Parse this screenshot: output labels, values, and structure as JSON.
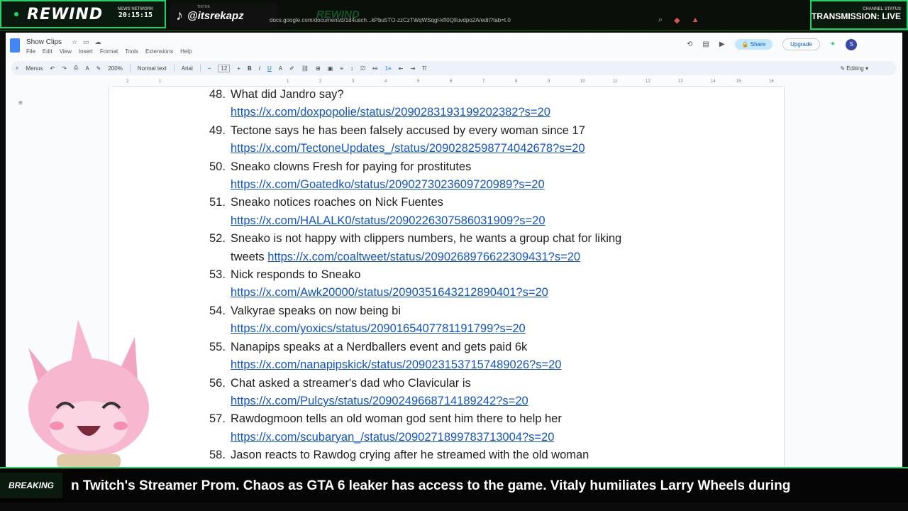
{
  "stream": {
    "brand": "REWIND",
    "clock_label": "NEWS NETWORK",
    "clock_time": "20:15:15",
    "tiktok_label": "TIKTOK",
    "tiktok_handle": "@itsrekapz",
    "ghost_brand": "REWIND",
    "status_label": "CHANNEL STATUS",
    "status_value": "TRANSMISSION: LIVE",
    "breaking_label": "BREAKING",
    "ticker": "n Twitch's Streamer Prom. Chaos as GTA 6 leaker has access to the game. Vitaly humiliates Larry Wheels during",
    "accent_color": "#22d36a"
  },
  "browser": {
    "url": "docs.google.com/document/d/1d4usch...kPbu5TO-zzCzTWqWSqgl-kfI0QlIuvdpo2A/edit?tab=t.0"
  },
  "docs": {
    "title": "Show Clips",
    "menu": [
      "File",
      "Edit",
      "View",
      "Insert",
      "Format",
      "Tools",
      "Extensions",
      "Help"
    ],
    "share_label": "Share",
    "upgrade_label": "Upgrade",
    "avatar_initial": "S",
    "toolbar": {
      "menus_label": "Menus",
      "zoom": "200%",
      "style": "Normal text",
      "font": "Arial",
      "font_size": "12",
      "mode": "Editing"
    },
    "ruler_ticks": [
      "2",
      "1",
      "1",
      "1",
      "2",
      "3",
      "4",
      "5",
      "6",
      "7",
      "8",
      "9",
      "10",
      "11",
      "12",
      "13",
      "14",
      "15",
      "16",
      "17",
      "18"
    ]
  },
  "items": [
    {
      "num": "48.",
      "text": "What did Jandro say?",
      "link": "https://x.com/doxpopolie/status/2090283193199202382?s=20",
      "link_inline": false
    },
    {
      "num": "49.",
      "text": "Tectone says he has been falsely accused by every woman since 17",
      "link": "https://x.com/TectoneUpdates_/status/2090282598774042678?s=20",
      "link_inline": false
    },
    {
      "num": "50.",
      "text": "Sneako clowns Fresh for paying for prostitutes",
      "link": "https://x.com/Goatedko/status/2090273023609720989?s=20",
      "link_inline": false
    },
    {
      "num": "51.",
      "text": "Sneako notices roaches on Nick Fuentes",
      "link": "https://x.com/HALALK0/status/2090226307586031909?s=20",
      "link_inline": false
    },
    {
      "num": "52.",
      "text": "Sneako is not happy with clippers numbers, he wants a group chat for liking",
      "text2": "tweets",
      "link": "https://x.com/coaltweet/status/2090268976622309431?s=20",
      "link_inline": true
    },
    {
      "num": "53.",
      "text": "Nick responds to Sneako",
      "link": "https://x.com/Awk20000/status/2090351643212890401?s=20",
      "link_inline": false
    },
    {
      "num": "54.",
      "text": "Valkyrae speaks on now being bi",
      "link": "https://x.com/yoxics/status/2090165407781191799?s=20",
      "link_inline": false
    },
    {
      "num": "55.",
      "text": "Nanapips speaks at a Nerdballers event and gets paid 6k",
      "link": "https://x.com/nanapipskick/status/2090231537157489026?s=20",
      "link_inline": false
    },
    {
      "num": "56.",
      "text": "Chat asked a streamer's dad who Clavicular is",
      "link": "https://x.com/Pulcys/status/2090249668714189242?s=20",
      "link_inline": false
    },
    {
      "num": "57.",
      "text": "Rawdogmoon tells an old woman god sent him there to help her",
      "link": "https://x.com/scubaryan_/status/2090271899783713004?s=20",
      "link_inline": false
    },
    {
      "num": "58.",
      "text": "Jason reacts to Rawdog crying after he streamed with the old woman",
      "link": "",
      "link_inline": false
    }
  ]
}
